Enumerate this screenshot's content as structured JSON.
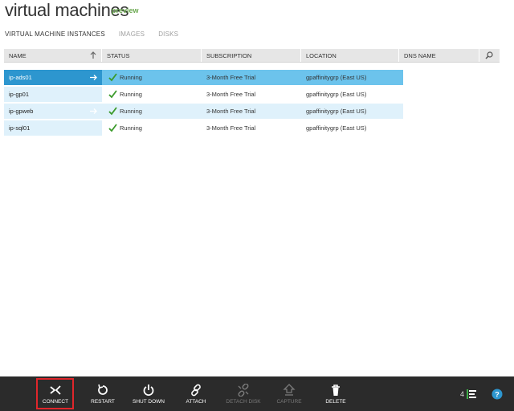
{
  "header": {
    "title": "virtual machines",
    "badge": "preview"
  },
  "tabs": [
    {
      "label": "VIRTUAL MACHINE INSTANCES"
    },
    {
      "label": "IMAGES"
    },
    {
      "label": "DISKS"
    }
  ],
  "grid": {
    "columns": [
      "NAME",
      "STATUS",
      "SUBSCRIPTION",
      "LOCATION",
      "DNS NAME"
    ],
    "rows": [
      {
        "name": "ip-ads01",
        "status": "Running",
        "subscription": "3-Month Free Trial",
        "location": "gpaffinitygrp (East US)"
      },
      {
        "name": "ip-gp01",
        "status": "Running",
        "subscription": "3-Month Free Trial",
        "location": "gpaffinitygrp (East US)"
      },
      {
        "name": "ip-gpweb",
        "status": "Running",
        "subscription": "3-Month Free Trial",
        "location": "gpaffinitygrp (East US)"
      },
      {
        "name": "ip-sql01",
        "status": "Running",
        "subscription": "3-Month Free Trial",
        "location": "gpaffinitygrp (East US)"
      }
    ]
  },
  "toolbar": {
    "connect": "CONNECT",
    "restart": "RESTART",
    "shutdown": "SHUT DOWN",
    "attach": "ATTACH",
    "detach": "DETACH DISK",
    "capture": "CAPTURE",
    "delete": "DELETE",
    "count": "4"
  },
  "colors": {
    "accent": "#2d96cf",
    "selected_row": "#6cc3ec",
    "toolbar_bg": "#2b2b2b",
    "highlight": "#e0262b",
    "success": "#6aa84f"
  }
}
